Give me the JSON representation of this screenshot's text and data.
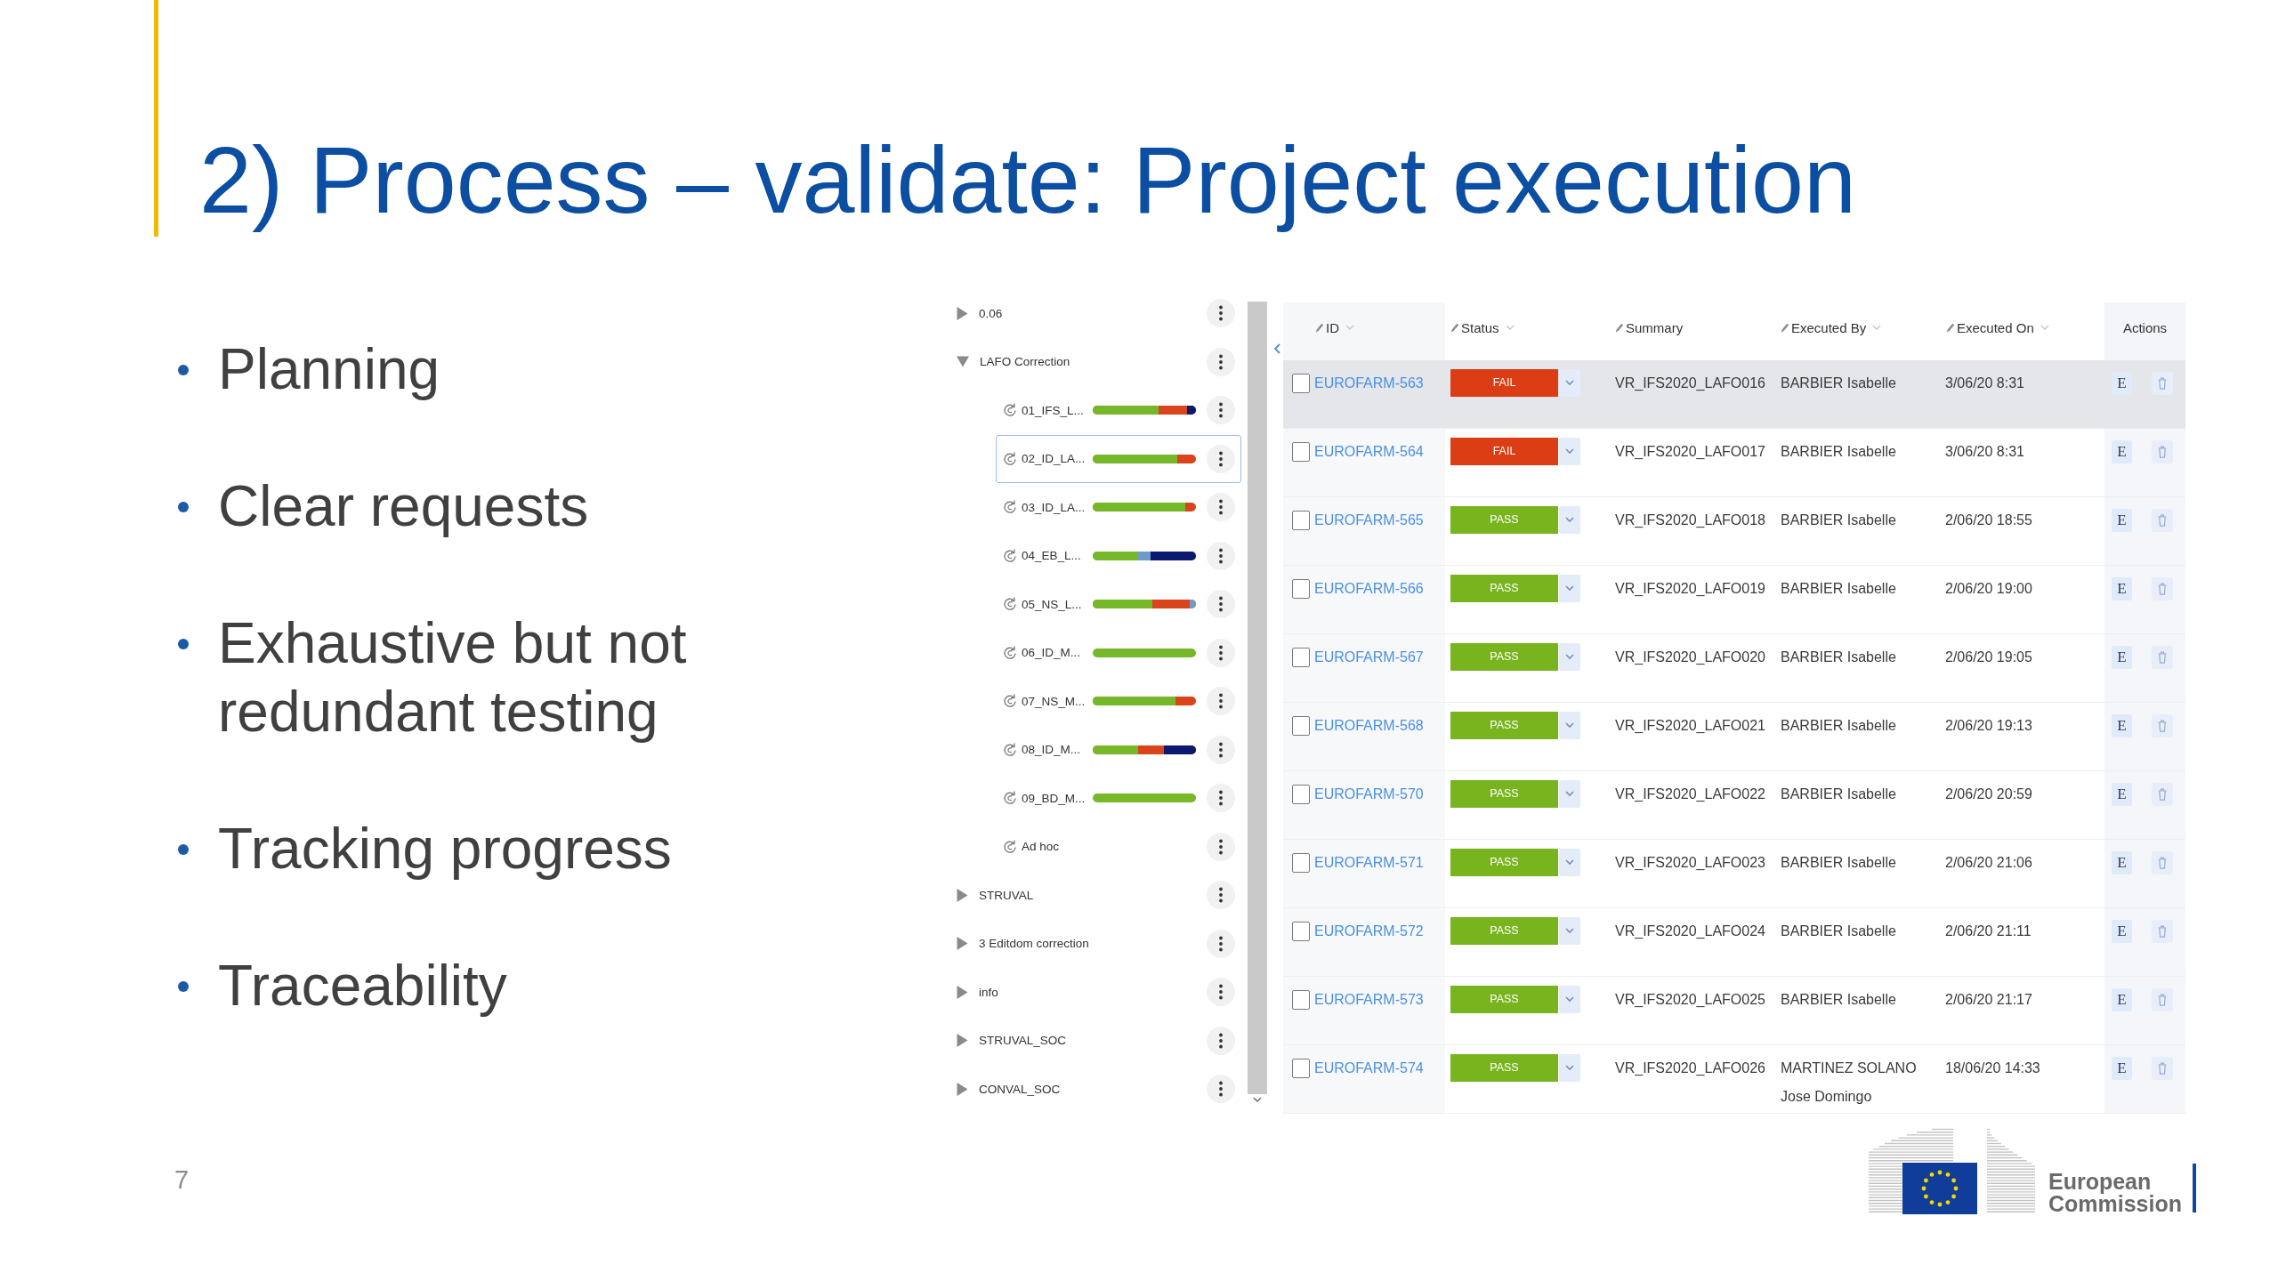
{
  "slide": {
    "title": "2) Process – validate: Project execution",
    "bullets": [
      "Planning",
      "Clear requests",
      "Exhaustive but not redundant testing",
      "Tracking progress",
      "Traceability"
    ]
  },
  "tree": [
    {
      "label": "0.06",
      "expanded": false,
      "selected": false
    },
    {
      "label": "LAFO Correction",
      "expanded": true,
      "selected": false,
      "children": [
        {
          "label": "01_IFS_L...",
          "selected": false,
          "bar": {
            "color": "#d9441d",
            "start": {
              "level": 0.64,
              "color": "#76b82a"
            },
            "end": {
              "level": 0.09,
              "color": "#0d1870"
            }
          }
        },
        {
          "label": "02_ID_LA...",
          "selected": true,
          "bar": {
            "color": "#d9441d",
            "start": {
              "level": 0.82,
              "color": "#76b82a"
            }
          }
        },
        {
          "label": "03_ID_LA...",
          "selected": false,
          "bar": {
            "color": "#d9441d",
            "start": {
              "level": 0.9,
              "color": "#76b82a"
            }
          }
        },
        {
          "label": "04_EB_L...",
          "selected": false,
          "bar": {
            "color": "#6f9cc7",
            "start": {
              "level": 0.44,
              "color": "#76b82a"
            },
            "end": {
              "level": 0.44,
              "color": "#0d1870"
            }
          }
        },
        {
          "label": "05_NS_L...",
          "selected": false,
          "bar": {
            "color": "#d9441d",
            "start": {
              "level": 0.58,
              "color": "#76b82a"
            },
            "end": {
              "level": 0.06,
              "color": "#6f9cc7"
            }
          }
        },
        {
          "label": "06_ID_M...",
          "selected": false,
          "bar": {
            "color": "#76b82a"
          }
        },
        {
          "label": "07_NS_M...",
          "selected": false,
          "bar": {
            "color": "#d9441d",
            "start": {
              "level": 0.8,
              "color": "#76b82a"
            }
          }
        },
        {
          "label": "08_ID_M...",
          "selected": false,
          "bar": {
            "color": "#d9441d",
            "start": {
              "level": 0.44,
              "color": "#76b82a"
            },
            "end": {
              "level": 0.31,
              "color": "#0d1870"
            }
          }
        },
        {
          "label": "09_BD_M...",
          "selected": false,
          "bar": {
            "color": "#76b82a"
          }
        },
        {
          "label": "Ad hoc",
          "selected": false
        }
      ]
    },
    {
      "label": "STRUVAL",
      "expanded": false,
      "selected": false
    },
    {
      "label": "3 Editdom correction",
      "expanded": false,
      "selected": false
    },
    {
      "label": "info",
      "expanded": false,
      "selected": false
    },
    {
      "label": "STRUVAL_SOC",
      "expanded": false,
      "selected": false
    },
    {
      "label": "CONVAL_SOC",
      "expanded": false,
      "selected": false
    }
  ],
  "table": {
    "columns": [
      {
        "label": "ID",
        "editable": true,
        "sortable": true
      },
      {
        "label": "Status",
        "editable": true,
        "sortable": true
      },
      {
        "label": "Summary",
        "editable": true,
        "sortable": false
      },
      {
        "label": "Executed By",
        "editable": true,
        "sortable": true
      },
      {
        "label": "Executed On",
        "editable": true,
        "sortable": true
      },
      {
        "label": "Actions",
        "editable": false,
        "sortable": false
      }
    ],
    "rows": [
      {
        "selected": true,
        "checked": false,
        "id": "EUROFARM-563",
        "status": {
          "label": "FAIL",
          "color": "#db3e14"
        },
        "summary": "VR_IFS2020_LAFO016",
        "executed_by": "BARBIER Isabelle",
        "executed_on": "3/06/20 8:31",
        "action": "E"
      },
      {
        "selected": false,
        "checked": false,
        "id": "EUROFARM-564",
        "status": {
          "label": "FAIL",
          "color": "#db3e14"
        },
        "summary": "VR_IFS2020_LAFO017",
        "executed_by": "BARBIER Isabelle",
        "executed_on": "3/06/20 8:31",
        "action": "E"
      },
      {
        "selected": false,
        "checked": false,
        "id": "EUROFARM-565",
        "status": {
          "label": "PASS",
          "color": "#78b41e"
        },
        "summary": "VR_IFS2020_LAFO018",
        "executed_by": "BARBIER Isabelle",
        "executed_on": "2/06/20 18:55",
        "action": "E"
      },
      {
        "selected": false,
        "checked": false,
        "id": "EUROFARM-566",
        "status": {
          "label": "PASS",
          "color": "#78b41e"
        },
        "summary": "VR_IFS2020_LAFO019",
        "executed_by": "BARBIER Isabelle",
        "executed_on": "2/06/20 19:00",
        "action": "E"
      },
      {
        "selected": false,
        "checked": false,
        "id": "EUROFARM-567",
        "status": {
          "label": "PASS",
          "color": "#78b41e"
        },
        "summary": "VR_IFS2020_LAFO020",
        "executed_by": "BARBIER Isabelle",
        "executed_on": "2/06/20 19:05",
        "action": "E"
      },
      {
        "selected": false,
        "checked": false,
        "id": "EUROFARM-568",
        "status": {
          "label": "PASS",
          "color": "#78b41e"
        },
        "summary": "VR_IFS2020_LAFO021",
        "executed_by": "BARBIER Isabelle",
        "executed_on": "2/06/20 19:13",
        "action": "E"
      },
      {
        "selected": false,
        "checked": false,
        "id": "EUROFARM-570",
        "status": {
          "label": "PASS",
          "color": "#78b41e"
        },
        "summary": "VR_IFS2020_LAFO022",
        "executed_by": "BARBIER Isabelle",
        "executed_on": "2/06/20 20:59",
        "action": "E"
      },
      {
        "selected": false,
        "checked": false,
        "id": "EUROFARM-571",
        "status": {
          "label": "PASS",
          "color": "#78b41e"
        },
        "summary": "VR_IFS2020_LAFO023",
        "executed_by": "BARBIER Isabelle",
        "executed_on": "2/06/20 21:06",
        "action": "E"
      },
      {
        "selected": false,
        "checked": false,
        "id": "EUROFARM-572",
        "status": {
          "label": "PASS",
          "color": "#78b41e"
        },
        "summary": "VR_IFS2020_LAFO024",
        "executed_by": "BARBIER Isabelle",
        "executed_on": "2/06/20 21:11",
        "action": "E"
      },
      {
        "selected": false,
        "checked": false,
        "id": "EUROFARM-573",
        "status": {
          "label": "PASS",
          "color": "#78b41e"
        },
        "summary": "VR_IFS2020_LAFO025",
        "executed_by": "BARBIER Isabelle",
        "executed_on": "2/06/20 21:17",
        "action": "E"
      },
      {
        "selected": false,
        "checked": false,
        "id": "EUROFARM-574",
        "status": {
          "label": "PASS",
          "color": "#78b41e"
        },
        "summary": "VR_IFS2020_LAFO026",
        "executed_by": "MARTINEZ SOLANO Jose Domingo",
        "executed_on": "18/06/20 14:33",
        "action": "E"
      }
    ]
  },
  "footer": {
    "page_number": "7",
    "logo_lines": [
      "European",
      "Commission"
    ]
  }
}
